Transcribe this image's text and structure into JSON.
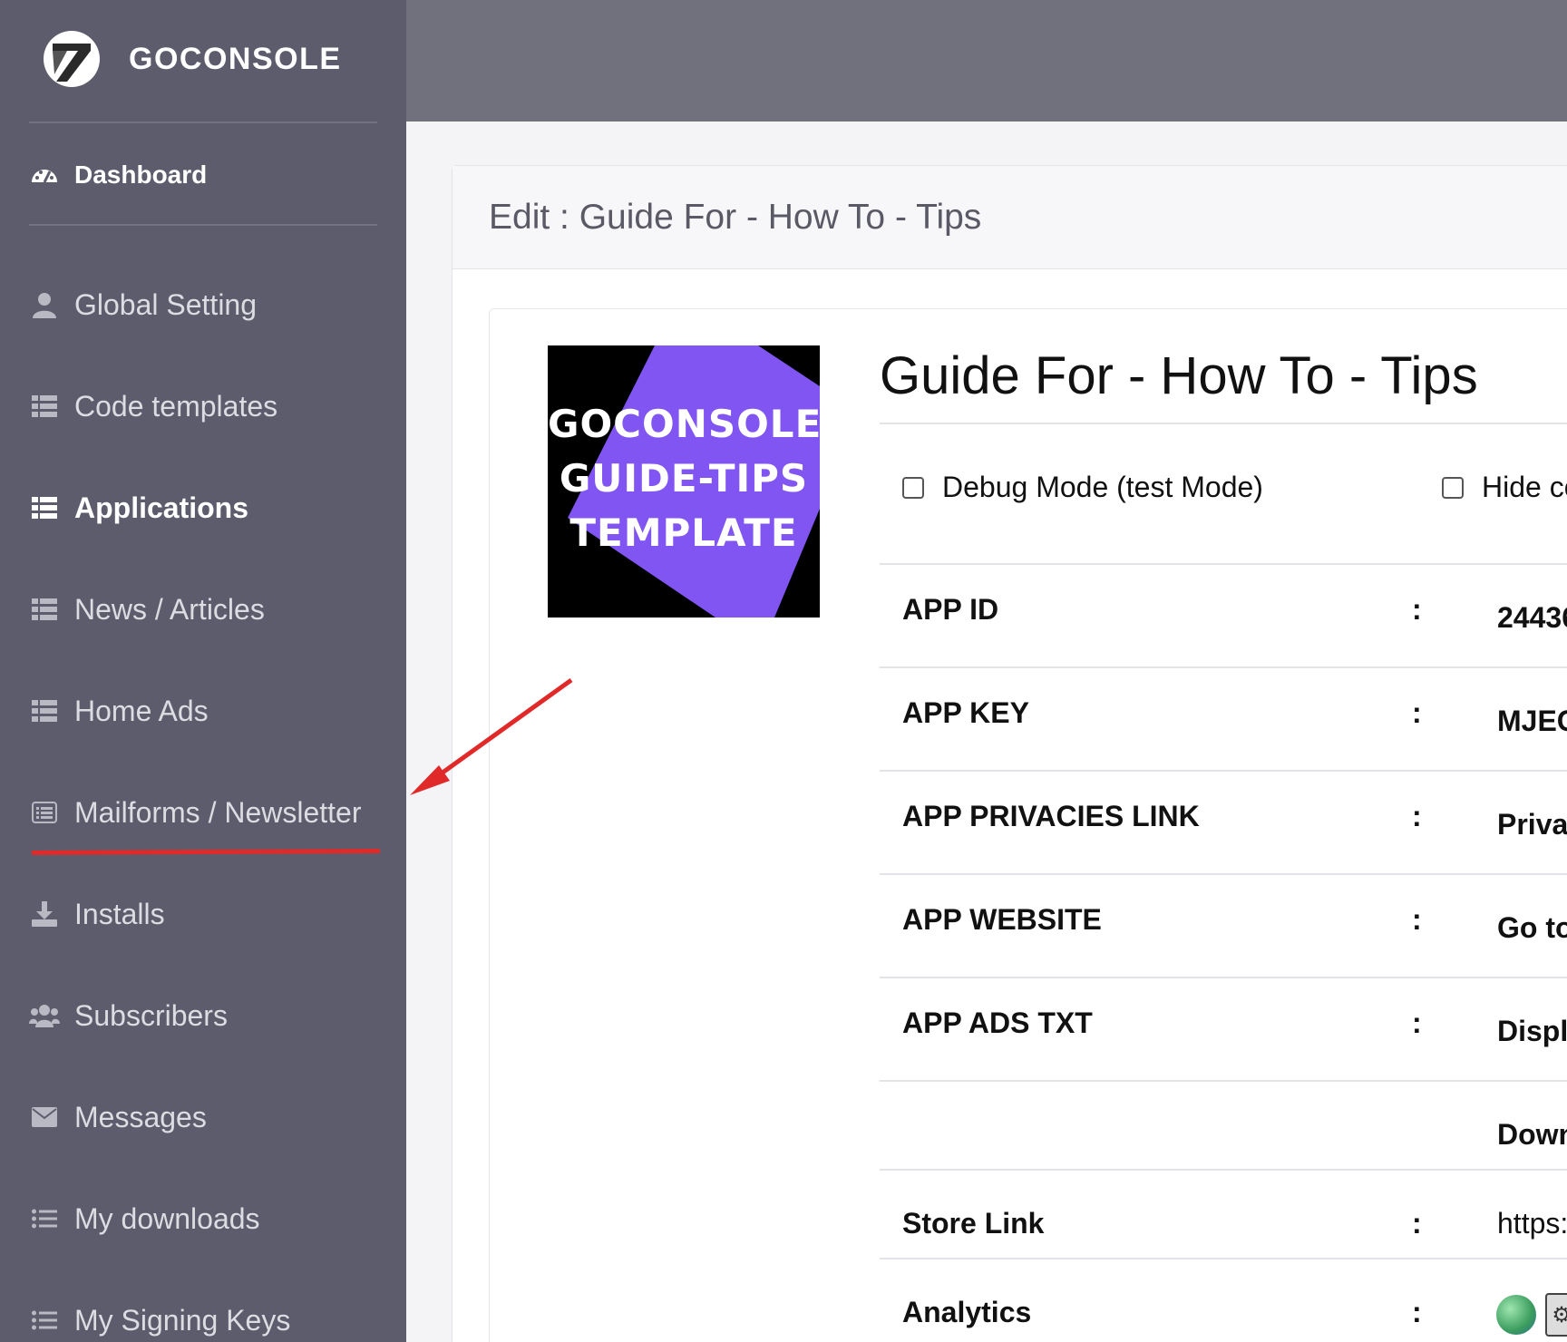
{
  "brand": {
    "name": "GOCONSOLE"
  },
  "sidebar": {
    "dashboard": {
      "label": "Dashboard",
      "icon": "tachometer-icon"
    },
    "items": [
      {
        "label": "Global Setting",
        "icon": "user-icon"
      },
      {
        "label": "Code templates",
        "icon": "list-icon"
      },
      {
        "label": "Applications",
        "icon": "list-icon",
        "active": true
      },
      {
        "label": "News / Articles",
        "icon": "list-icon"
      },
      {
        "label": "Home Ads",
        "icon": "list-icon"
      },
      {
        "label": "Mailforms / Newsletter",
        "icon": "list-alt-icon"
      },
      {
        "label": "Installs",
        "icon": "download-icon"
      },
      {
        "label": "Subscribers",
        "icon": "users-icon"
      },
      {
        "label": "Messages",
        "icon": "envelope-icon"
      },
      {
        "label": "My downloads",
        "icon": "list-ul-icon"
      },
      {
        "label": "My Signing Keys",
        "icon": "list-ul-icon"
      }
    ]
  },
  "page": {
    "header_title": "Edit : Guide For - How To - Tips"
  },
  "app": {
    "image_text": [
      "GOCONSOLE",
      "GUIDE-TIPS",
      "TEMPLATE"
    ],
    "title": "Guide For - How To - Tips",
    "checkboxes": [
      {
        "label": "Debug Mode (test Mode)",
        "checked": false
      },
      {
        "label": "Hide co",
        "checked": false
      }
    ],
    "rows": [
      {
        "label": "APP ID",
        "colon": ":",
        "value": "24436"
      },
      {
        "label": "APP KEY",
        "colon": ":",
        "value": "MJEC"
      },
      {
        "label": "APP PRIVACIES LINK",
        "colon": ":",
        "value": "Priva"
      },
      {
        "label": "APP WEBSITE",
        "colon": ":",
        "value": "Go to"
      },
      {
        "label": "APP ADS TXT",
        "colon": ":",
        "value": "Displ"
      },
      {
        "label": "",
        "colon": "",
        "value": "Down"
      },
      {
        "label": "Store Link",
        "colon": ":",
        "value": "https:"
      },
      {
        "label": "Analytics",
        "colon": ":",
        "value": ""
      }
    ]
  },
  "colors": {
    "sidebar_bg": "#5c5c6c",
    "topbar_bg": "#71717d",
    "accent_purple": "#8155f2",
    "annotation_red": "#e02a2a"
  }
}
